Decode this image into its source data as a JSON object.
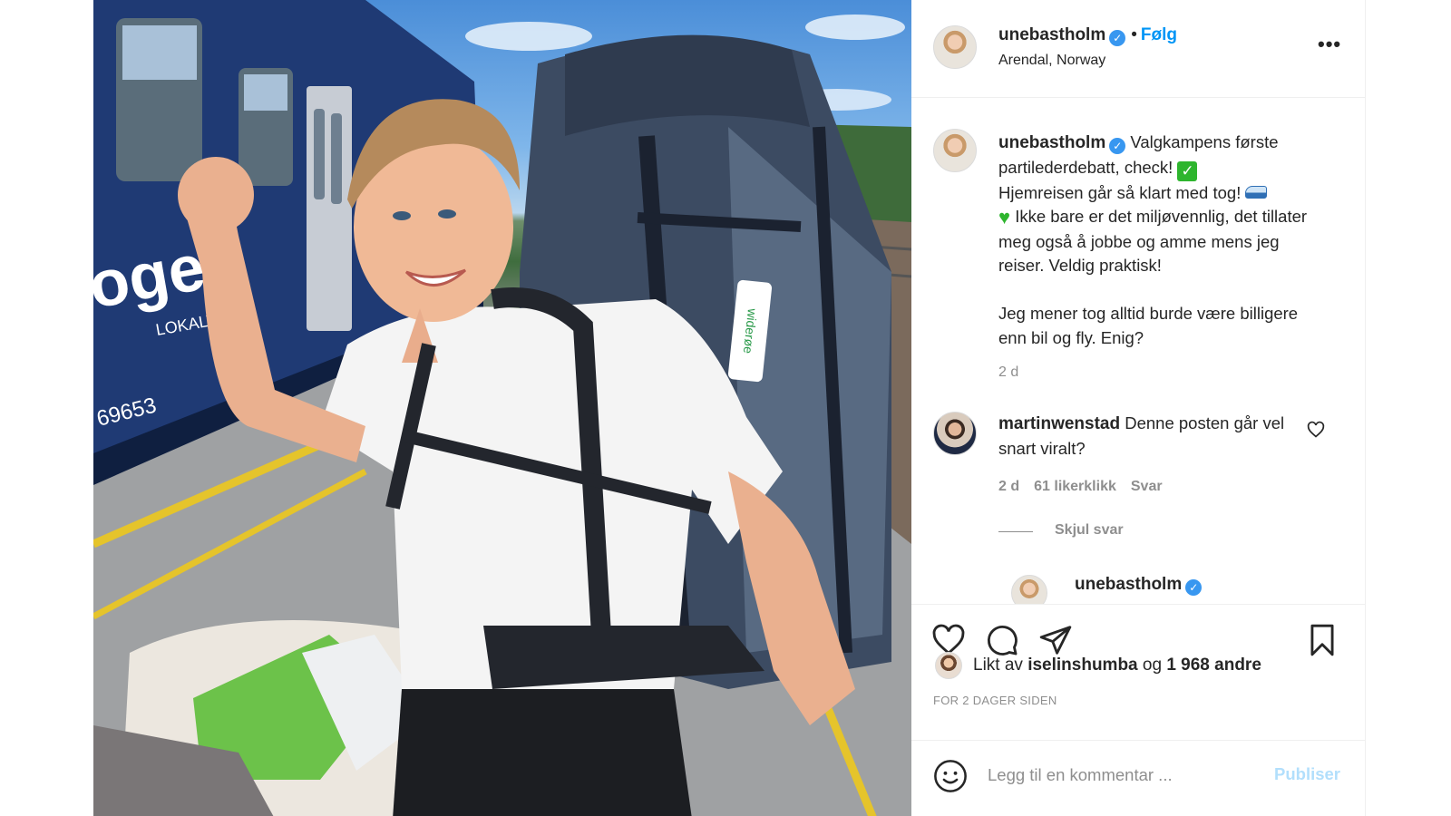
{
  "header": {
    "username": "unebastholm",
    "verified_icon": "verified-badge-icon",
    "dot": "•",
    "follow_label": "Følg",
    "location": "Arendal, Norway",
    "more_label": "•••"
  },
  "caption": {
    "username": "unebastholm",
    "line1": "Valgkampens første partilederdebatt, check!",
    "line2": "Hjemreisen går så klart med tog!",
    "line3": "Ikke bare er det miljøvennlig, det tillater meg også å jobbe og amme mens jeg reiser. Veldig praktisk!",
    "line4": "Jeg mener tog alltid burde være billigere enn bil og fly. Enig?",
    "check_emoji": "✓",
    "heart_emoji": "♥",
    "time": "2 d"
  },
  "comment": {
    "username": "martinwenstad",
    "text": "Denne posten går vel snart viralt?",
    "time": "2 d",
    "likes": "61 likerklikk",
    "reply_label": "Svar",
    "hide_replies": "Skjul svar",
    "reply_username": "unebastholm"
  },
  "actions": {
    "icons": [
      "heart-icon",
      "comment-icon",
      "share-icon",
      "bookmark-icon"
    ],
    "liked_by_prefix": "Likt av",
    "liked_by_user": "iselinshumba",
    "liked_by_joiner": "og",
    "liked_by_count": "1 968 andre",
    "posted": "FOR 2 DAGER SIDEN"
  },
  "add_comment": {
    "placeholder": "Legg til en kommentar ...",
    "publish_label": "Publiser"
  },
  "photo": {
    "train_text_1": "oget",
    "train_text_2": "LOKALT",
    "train_number": "69653",
    "tag_text": "widerøe"
  },
  "colors": {
    "accent": "#0095f6",
    "publish_disabled": "#b2dffc",
    "verified": "#3897f0",
    "secondary_text": "#8e8e8e"
  }
}
